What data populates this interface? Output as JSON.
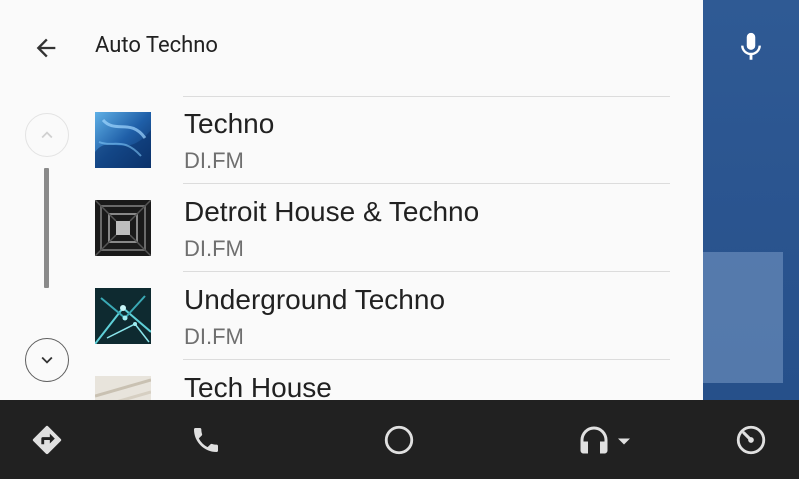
{
  "drawer": {
    "title": "Auto Techno"
  },
  "stations": [
    {
      "title": "Techno",
      "subtitle": "DI.FM",
      "art": "blue-abstract"
    },
    {
      "title": "Detroit House & Techno",
      "subtitle": "DI.FM",
      "art": "dark-corridor"
    },
    {
      "title": "Underground Techno",
      "subtitle": "DI.FM",
      "art": "teal-network"
    },
    {
      "title": "Tech House",
      "subtitle": "",
      "art": "light-pattern"
    }
  ],
  "icons": {
    "back": "arrow-back-icon",
    "scroll_up": "chevron-up-icon",
    "scroll_down": "chevron-down-icon",
    "mic": "microphone-icon",
    "navigation": "directions-icon",
    "phone": "phone-icon",
    "home": "home-circle-icon",
    "media": "headphones-icon",
    "exit": "exit-dashboard-icon"
  },
  "colors": {
    "accent_bg": "#2b5590",
    "bottom_bar": "#212121",
    "drawer_bg": "#fafafa"
  }
}
